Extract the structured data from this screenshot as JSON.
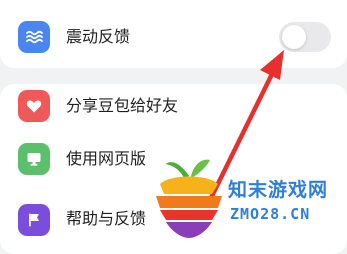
{
  "settings": {
    "vibration": {
      "label": "震动反馈",
      "enabled": false,
      "icon": "wave-icon",
      "icon_color": "#4a86f0"
    },
    "items": [
      {
        "label": "分享豆包给好友",
        "icon": "heart-icon",
        "icon_color": "#ee5a5a"
      },
      {
        "label": "使用网页版",
        "icon": "monitor-icon",
        "icon_color": "#5cbf6b"
      },
      {
        "label": "帮助与反馈",
        "icon": "flag-icon",
        "icon_color": "#7b4ddb"
      }
    ]
  },
  "annotation": {
    "arrow_color": "#e5302d"
  },
  "watermark": {
    "name": "知末游戏网",
    "url": "ZMO28.CN",
    "color": "#2f7fd6"
  }
}
